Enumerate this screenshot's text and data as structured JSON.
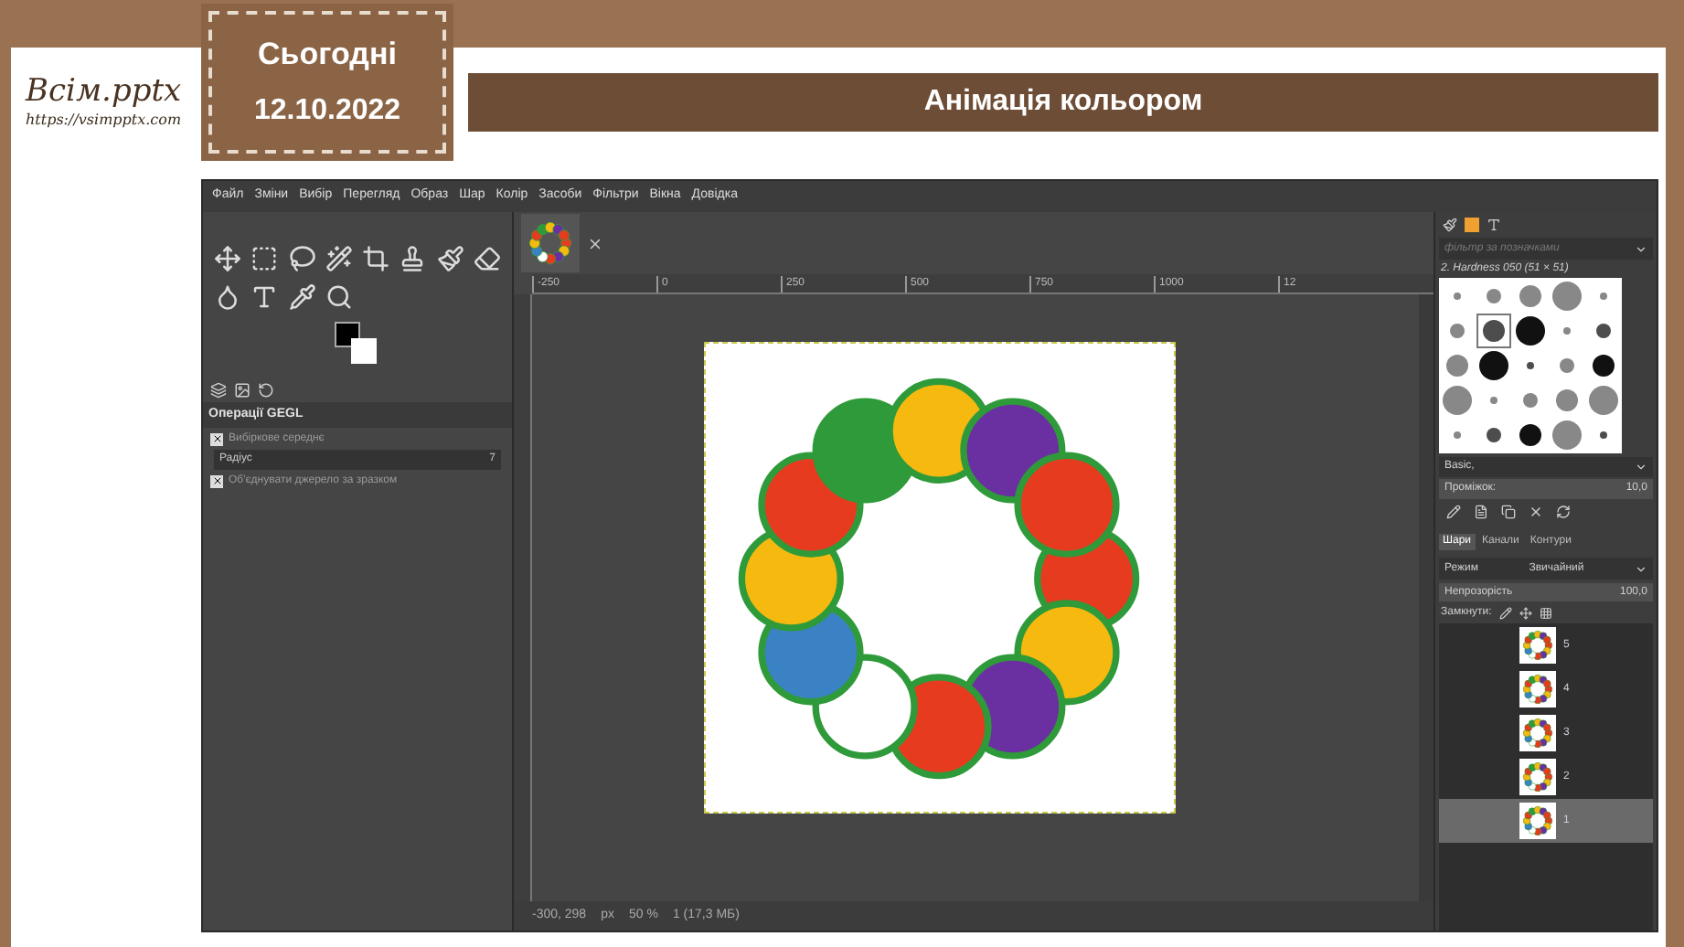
{
  "slide": {
    "logo": "Всім.pptx",
    "logo_url": "https://vsimpptx.com",
    "date_label": "Сьогодні",
    "date": "12.10.2022",
    "title": "Анімація кольором"
  },
  "gimp": {
    "menu": [
      "Файл",
      "Зміни",
      "Вибір",
      "Перегляд",
      "Образ",
      "Шар",
      "Колір",
      "Засоби",
      "Фільтри",
      "Вікна",
      "Довідка"
    ],
    "tool_options": {
      "title": "Операції GEGL",
      "options": [
        {
          "kind": "checkbox",
          "label": "Вибіркове середнє",
          "checked": true
        },
        {
          "kind": "spin",
          "label": "Радіус",
          "value": "7"
        },
        {
          "kind": "checkbox",
          "label": "Об'єднувати джерело за зразком",
          "checked": true
        }
      ]
    },
    "ruler_ticks": [
      "-250",
      "0",
      "250",
      "500",
      "750",
      "1000",
      "12"
    ],
    "brushes": {
      "filter_placeholder": "фільтр за позначками",
      "selected_brush": "2. Hardness 050 (51 × 51)",
      "preset": "Basic,",
      "spacing_label": "Проміжок:",
      "spacing": "10,0"
    },
    "layers_tabs": [
      {
        "label": "Шари",
        "selected": true
      },
      {
        "label": "Канали",
        "selected": false
      },
      {
        "label": "Контури",
        "selected": false
      }
    ],
    "mode_label": "Режим",
    "mode": "Звичайний",
    "opacity_label": "Непрозорість",
    "opacity": "100,0",
    "lock_label": "Замкнути:",
    "layers": [
      {
        "name": "5",
        "selected": false
      },
      {
        "name": "4",
        "selected": false
      },
      {
        "name": "3",
        "selected": false
      },
      {
        "name": "2",
        "selected": false
      },
      {
        "name": "1",
        "selected": true
      }
    ],
    "status": {
      "coords": "-300, 298",
      "unit": "px",
      "zoom": "50 %",
      "info": "1 (17,3 МБ)"
    }
  }
}
